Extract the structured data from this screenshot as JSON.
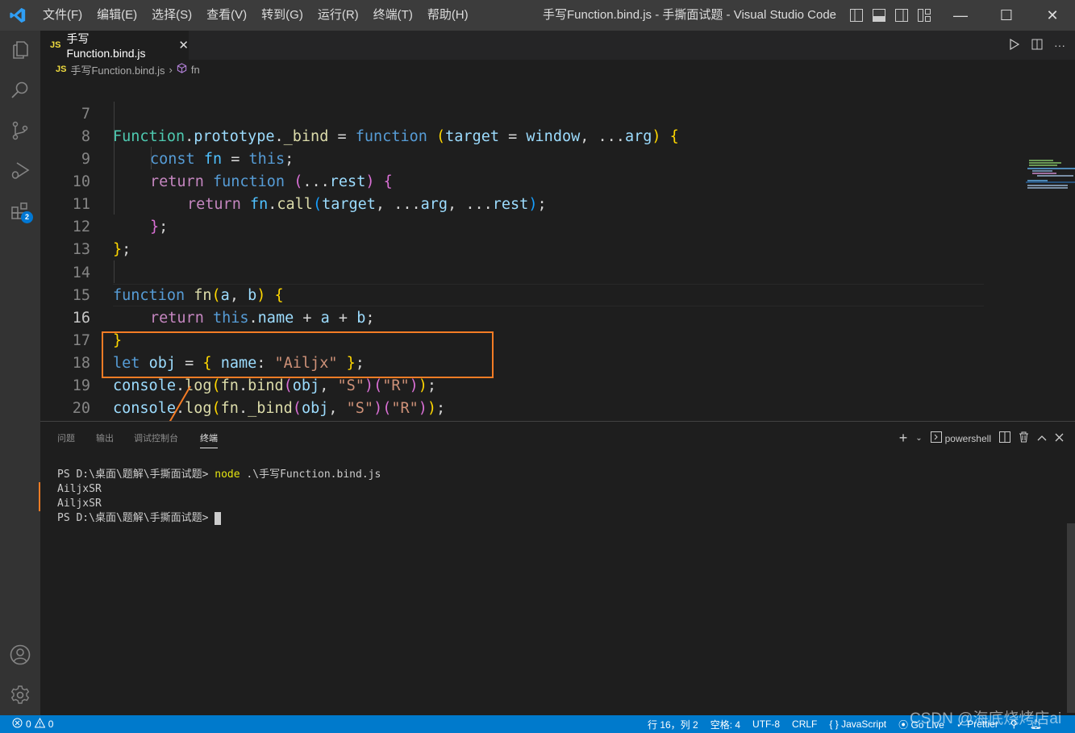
{
  "window": {
    "title": "手写Function.bind.js - 手撕面试题 - Visual Studio Code",
    "menu": [
      "文件(F)",
      "编辑(E)",
      "选择(S)",
      "查看(V)",
      "转到(G)",
      "运行(R)",
      "终端(T)",
      "帮助(H)"
    ],
    "controls": {
      "minimize": "—",
      "maximize": "☐",
      "close": "✕"
    }
  },
  "activity_bar": {
    "items": [
      "explorer-icon",
      "search-icon",
      "source-control-icon",
      "run-debug-icon",
      "extensions-icon"
    ],
    "extensions_badge": "2",
    "bottom": [
      "account-icon",
      "settings-gear-icon"
    ]
  },
  "tab": {
    "lang": "JS",
    "name": "手写Function.bind.js",
    "close": "✕"
  },
  "breadcrumb": {
    "lang": "JS",
    "file": "手写Function.bind.js",
    "sep": "›",
    "symbol": "fn"
  },
  "editor": {
    "current_line": 16,
    "lines": [
      {
        "n": "7"
      },
      {
        "n": "8"
      },
      {
        "n": "9"
      },
      {
        "n": "10"
      },
      {
        "n": "11"
      },
      {
        "n": "12"
      },
      {
        "n": "13"
      },
      {
        "n": "14"
      },
      {
        "n": "15"
      },
      {
        "n": "16"
      },
      {
        "n": "17"
      },
      {
        "n": "18"
      },
      {
        "n": "19"
      },
      {
        "n": "20"
      }
    ],
    "tokens": {
      "t_Function": "Function",
      "t_dot": ".",
      "t_prototype": "prototype",
      "t__bind": "_bind",
      "t_eq": " = ",
      "t_function": "function",
      "t_target": "target",
      "t_window": "window",
      "t_comma": ", ",
      "t_spread": "...",
      "t_arg": "arg",
      "t_lparen": "(",
      "t_rparen": ")",
      "t_lbrace": "{",
      "t_rbrace": "}",
      "t_semi": ";",
      "t_const": "const",
      "t_fn": "fn",
      "t_this": "this",
      "t_return": "return",
      "t_rest": "rest",
      "t_call": "call",
      "t_a": "a",
      "t_b": "b",
      "t_name": "name",
      "t_plus": " + ",
      "t_let": "let",
      "t_obj": "obj",
      "t_colon": ": ",
      "t_Ailjx": "\"Ailjx\"",
      "t_console": "console",
      "t_log": "log",
      "t_bind": "bind",
      "t_S": "\"S\"",
      "t_R": "\"R\"",
      "t_sp": " "
    }
  },
  "panel": {
    "tabs": [
      "问题",
      "输出",
      "调试控制台",
      "终端"
    ],
    "active_tab": "终端",
    "shell": "powershell",
    "terminal": {
      "prompt1": "PS D:\\桌面\\题解\\手撕面试题> ",
      "cmd": "node",
      "args": " .\\手写Function.bind.js",
      "output": [
        "AiljxSR",
        "AiljxSR"
      ],
      "prompt2": "PS D:\\桌面\\题解\\手撕面试题> "
    }
  },
  "statusbar": {
    "errors": "0",
    "warnings": "0",
    "position": "行 16，列 2",
    "spaces": "空格: 4",
    "encoding": "UTF-8",
    "eol": "CRLF",
    "language": "{ } JavaScript",
    "golive": "Go Live",
    "prettier": "Prettier"
  },
  "watermark": "CSDN @海底烧烤店ai",
  "colors": {
    "accent": "#007acc",
    "highlight": "#f47c25"
  }
}
